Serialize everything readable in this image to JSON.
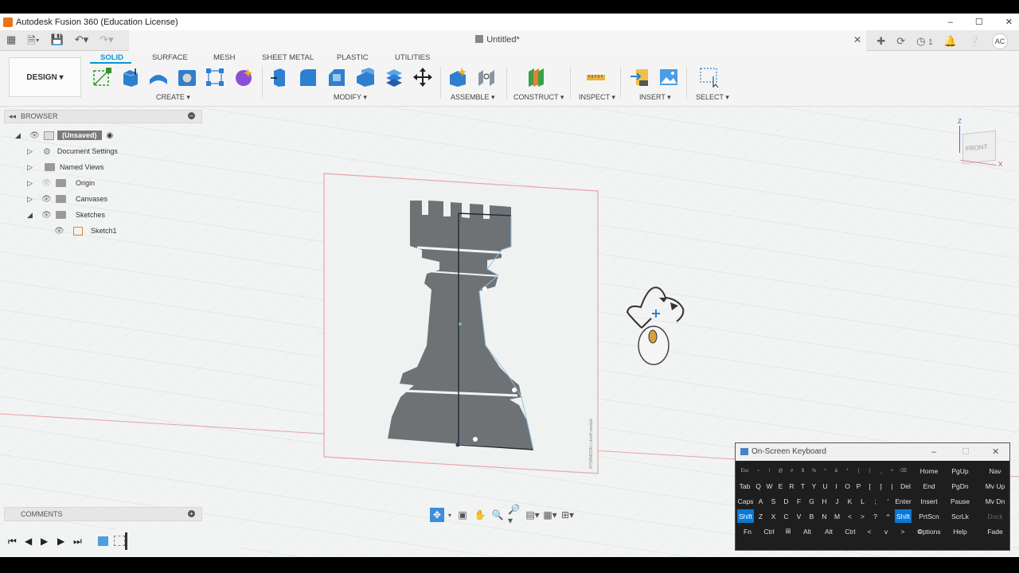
{
  "window": {
    "title": "Autodesk Fusion 360 (Education License)",
    "controls": [
      "–",
      "☐",
      "✕"
    ]
  },
  "tabbar": {
    "doc_title": "Untitled*",
    "job_count": "1",
    "avatar": "AC"
  },
  "ribbon": {
    "workspace": "DESIGN ▾",
    "tabs": [
      "SOLID",
      "SURFACE",
      "MESH",
      "SHEET METAL",
      "PLASTIC",
      "UTILITIES"
    ],
    "groups": [
      "CREATE ▾",
      "MODIFY ▾",
      "ASSEMBLE ▾",
      "CONSTRUCT ▾",
      "INSPECT ▾",
      "INSERT ▾",
      "SELECT ▾"
    ],
    "accent": "#0696d7"
  },
  "browser": {
    "header": "BROWSER",
    "root": "(Unsaved)",
    "items": [
      {
        "label": "Document Settings",
        "icon": "gear-icon"
      },
      {
        "label": "Named Views",
        "icon": "folder-icon"
      },
      {
        "label": "Origin",
        "icon": "folder-icon"
      },
      {
        "label": "Canvases",
        "icon": "folder-icon"
      },
      {
        "label": "Sketches",
        "icon": "folder-icon"
      }
    ],
    "sketch": "Sketch1"
  },
  "comments": {
    "label": "COMMENTS"
  },
  "viewcube": {
    "face": "FRONT",
    "axis_z": "Z",
    "axis_x": "X"
  },
  "osk": {
    "title": "On-Screen Keyboard",
    "rows": [
      [
        "Esc",
        "~",
        "!",
        "@",
        "#",
        "$",
        "%",
        "^",
        "&",
        "*",
        "(",
        ")",
        "_",
        "+",
        "⌫",
        "Home",
        "PgUp",
        "Nav"
      ],
      [
        "Tab",
        "Q",
        "W",
        "E",
        "R",
        "T",
        "Y",
        "U",
        "I",
        "O",
        "P",
        "[",
        "]",
        "|",
        "Del",
        "End",
        "PgDn",
        "Mv Up"
      ],
      [
        "Caps",
        "A",
        "S",
        "D",
        "F",
        "G",
        "H",
        "J",
        "K",
        "L",
        ";",
        "'",
        "Enter",
        "Insert",
        "Pause",
        "Mv Dn"
      ],
      [
        "Shift",
        "Z",
        "X",
        "C",
        "V",
        "B",
        "N",
        "M",
        "<",
        ">",
        "?",
        "^",
        "Shift",
        "PrtScn",
        "ScrLk",
        "Dock"
      ],
      [
        "Fn",
        "Ctrl",
        "⊞",
        "Alt",
        "Alt",
        "Ctrl",
        "<",
        "v",
        ">",
        "≡",
        "Options",
        "Help",
        "Fade"
      ]
    ]
  },
  "canvas_watermark": "8T59MDSH | dxoff ceotde"
}
